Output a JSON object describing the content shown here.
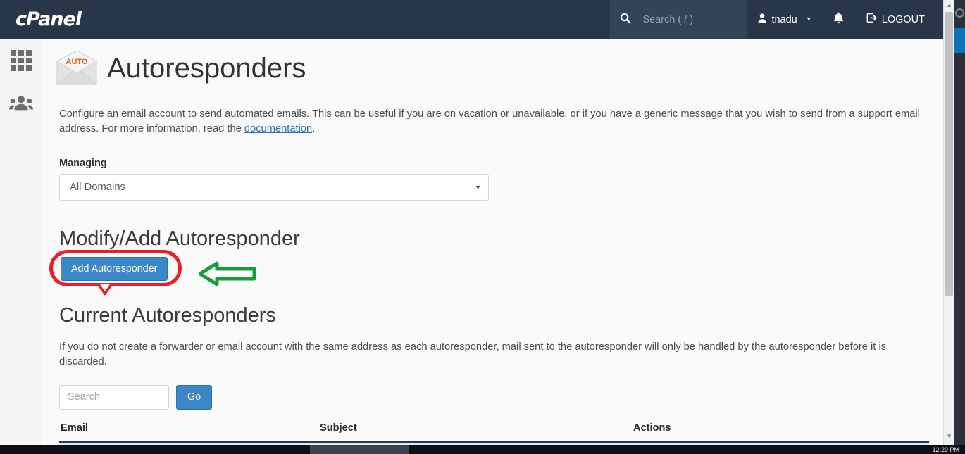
{
  "header": {
    "logo": "cPanel",
    "search": {
      "placeholder": "Search ( / )",
      "value": "",
      "icon": "search-icon"
    },
    "user": {
      "name": "tnadu",
      "icon": "user-icon",
      "caret": "▾"
    },
    "notifications": {
      "icon": "bell-icon",
      "glyph": "🔔"
    },
    "logout": {
      "label": "LOGOUT",
      "icon": "logout-icon"
    }
  },
  "sidebar": {
    "items": [
      {
        "name": "apps-grid-icon",
        "label": "Tools"
      },
      {
        "name": "users-group-icon",
        "label": "User Manager"
      }
    ]
  },
  "page": {
    "title": "Autoresponders",
    "icon_label": "AUTO",
    "description_part1": "Configure an email account to send automated emails. This can be useful if you are on vacation or unavailable, or if you have a generic message that you wish to send from a support email address. For more information, read the ",
    "description_link": "documentation",
    "description_part2": "."
  },
  "managing": {
    "label": "Managing",
    "selected": "All Domains",
    "caret": "▼"
  },
  "modify_add": {
    "heading": "Modify/Add Autoresponder",
    "add_button": "Add Autoresponder"
  },
  "current": {
    "heading": "Current Autoresponders",
    "note": "If you do not create a forwarder or email account with the same address as each autoresponder, mail sent to the autoresponder will only be handled by the autoresponder before it is discarded.",
    "search_placeholder": "Search",
    "search_value": "",
    "go_label": "Go",
    "columns": [
      "Email",
      "Subject",
      "Actions"
    ],
    "rows": []
  },
  "annotations": {
    "highlight_color": "#ee1c25",
    "arrow_color": "#1a9c3e",
    "target": "Add Autoresponder"
  },
  "scrollbar": {
    "up_arrow": "▲",
    "down_arrow": "▼"
  },
  "taskbar": {
    "clock": "12:29 PM"
  },
  "colors": {
    "topbar": "#273749",
    "primary_button": "#3b87c8",
    "link": "#2b6ea8",
    "table_row": "#d9eefb"
  }
}
